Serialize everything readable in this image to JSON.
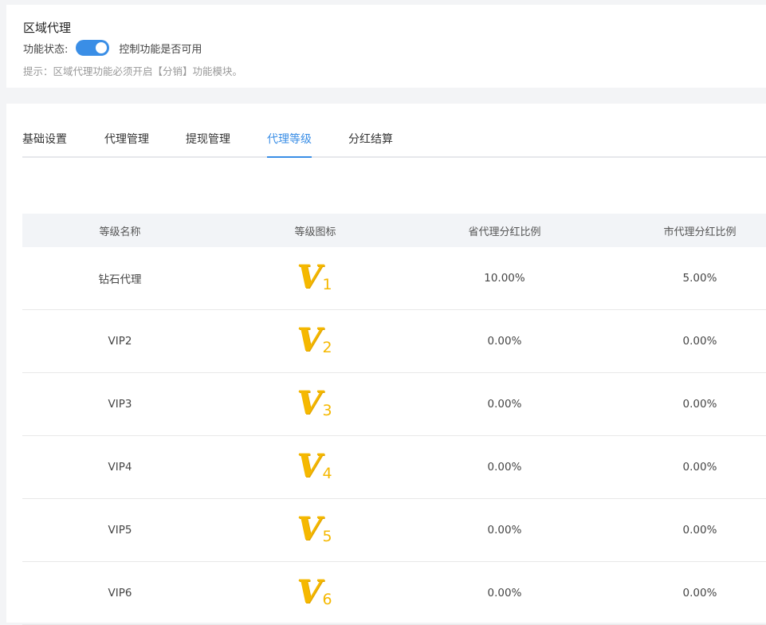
{
  "header": {
    "title": "区域代理",
    "status_label": "功能状态:",
    "status_on": true,
    "status_desc": "控制功能是否可用",
    "hint": "提示：区域代理功能必须开启【分销】功能模块。"
  },
  "tabs": [
    {
      "label": "基础设置",
      "active": false
    },
    {
      "label": "代理管理",
      "active": false
    },
    {
      "label": "提现管理",
      "active": false
    },
    {
      "label": "代理等级",
      "active": true
    },
    {
      "label": "分红结算",
      "active": false
    }
  ],
  "table": {
    "columns": [
      "等级名称",
      "等级图标",
      "省代理分红比例",
      "市代理分红比例"
    ],
    "rows": [
      {
        "name": "钻石代理",
        "icon_num": "1",
        "province": "10.00%",
        "city": "5.00%"
      },
      {
        "name": "VIP2",
        "icon_num": "2",
        "province": "0.00%",
        "city": "0.00%"
      },
      {
        "name": "VIP3",
        "icon_num": "3",
        "province": "0.00%",
        "city": "0.00%"
      },
      {
        "name": "VIP4",
        "icon_num": "4",
        "province": "0.00%",
        "city": "0.00%"
      },
      {
        "name": "VIP5",
        "icon_num": "5",
        "province": "0.00%",
        "city": "0.00%"
      },
      {
        "name": "VIP6",
        "icon_num": "6",
        "province": "0.00%",
        "city": "0.00%"
      }
    ]
  },
  "colors": {
    "accent": "#3a8ee6",
    "badge": "#f5b800"
  }
}
